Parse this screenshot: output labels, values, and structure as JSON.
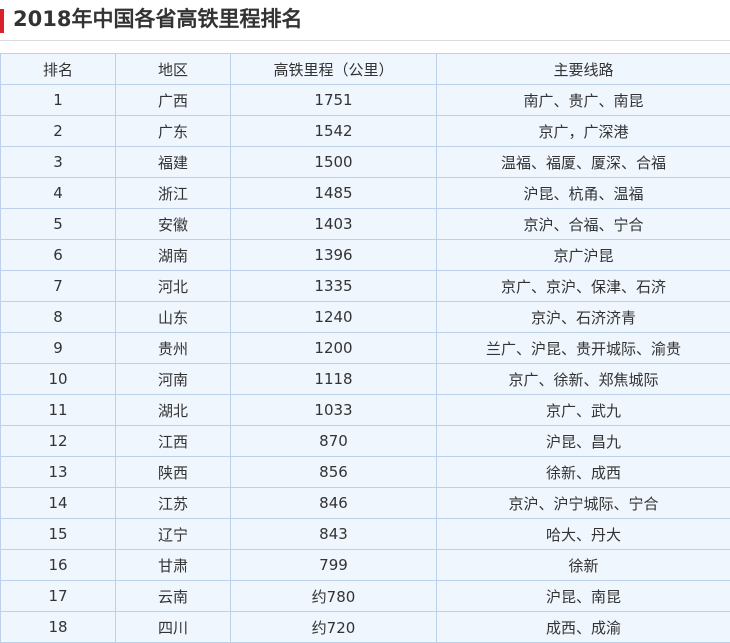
{
  "title": "2018年中国各省高铁里程排名",
  "colors": {
    "accent": "#d9202b",
    "table_bg": "#f0f6fd",
    "table_border": "#bdd2ea",
    "text": "#333333"
  },
  "table": {
    "headers": [
      "排名",
      "地区",
      "高铁里程（公里）",
      "主要线路"
    ],
    "rows": [
      [
        "1",
        "广西",
        "1751",
        "南广、贵广、南昆"
      ],
      [
        "2",
        "广东",
        "1542",
        "京广，广深港"
      ],
      [
        "3",
        "福建",
        "1500",
        "温福、福厦、厦深、合福"
      ],
      [
        "4",
        "浙江",
        "1485",
        "沪昆、杭甬、温福"
      ],
      [
        "5",
        "安徽",
        "1403",
        "京沪、合福、宁合"
      ],
      [
        "6",
        "湖南",
        "1396",
        "京广沪昆"
      ],
      [
        "7",
        "河北",
        "1335",
        "京广、京沪、保津、石济"
      ],
      [
        "8",
        "山东",
        "1240",
        "京沪、石济济青"
      ],
      [
        "9",
        "贵州",
        "1200",
        "兰广、沪昆、贵开城际、渝贵"
      ],
      [
        "10",
        "河南",
        "1118",
        "京广、徐新、郑焦城际"
      ],
      [
        "11",
        "湖北",
        "1033",
        "京广、武九"
      ],
      [
        "12",
        "江西",
        "870",
        "沪昆、昌九"
      ],
      [
        "13",
        "陕西",
        "856",
        "徐新、成西"
      ],
      [
        "14",
        "江苏",
        "846",
        "京沪、沪宁城际、宁合"
      ],
      [
        "15",
        "辽宁",
        "843",
        "哈大、丹大"
      ],
      [
        "16",
        "甘肃",
        "799",
        "徐新"
      ],
      [
        "17",
        "云南",
        "约780",
        "沪昆、南昆"
      ],
      [
        "18",
        "四川",
        "约720",
        "成西、成渝"
      ]
    ]
  }
}
